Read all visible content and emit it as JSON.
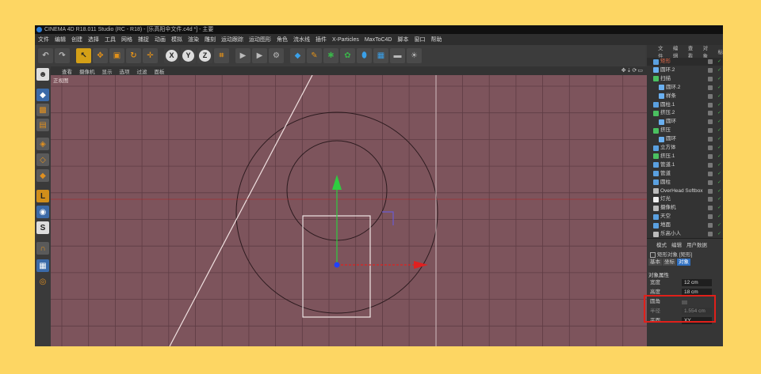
{
  "window": {
    "title": "CINEMA 4D R18.011 Studio (RC - R18) - [乐高阳伞文件.c4d *] - 主要"
  },
  "menu": [
    "文件",
    "编辑",
    "创建",
    "选择",
    "工具",
    "网格",
    "捕捉",
    "动画",
    "模拟",
    "渲染",
    "雕刻",
    "运动跟踪",
    "运动图形",
    "角色",
    "流水线",
    "插件",
    "X-Particles",
    "MaxToC4D",
    "脚本",
    "窗口",
    "帮助"
  ],
  "toolbar": {
    "axis_x": "X",
    "axis_y": "Y",
    "axis_z": "Z"
  },
  "viewport": {
    "menu": [
      "查看",
      "摄像机",
      "显示",
      "选项",
      "过滤",
      "面板"
    ],
    "label": "正视图",
    "nav_icons": "✥⇣⟳▭",
    "colors": {
      "bg": "#7d545c",
      "grid": "#5e3c44",
      "circle": "#2b1a1e",
      "rect": "#f1e6e6",
      "line": "#f0e0e0",
      "y_axis": "#2ecc40",
      "x_axis": "#e02020",
      "origin": "#2240ff"
    }
  },
  "objects_panel": {
    "tabs": [
      "文件",
      "编辑",
      "查看",
      "对象",
      "标"
    ],
    "items": [
      {
        "name": "矩形",
        "color": "#5aa0e0",
        "selected": true,
        "indent": 0,
        "name_color": "#e06a4a"
      },
      {
        "name": "圆环.2",
        "color": "#6ab0f0",
        "indent": 0
      },
      {
        "name": "扫描",
        "color": "#4ac060",
        "indent": 0
      },
      {
        "name": "圆环.2",
        "color": "#6ab0f0",
        "indent": 1
      },
      {
        "name": "样条",
        "color": "#6ab0f0",
        "indent": 1
      },
      {
        "name": "圆柱.1",
        "color": "#5aa0e0",
        "indent": 0
      },
      {
        "name": "挤压.2",
        "color": "#4ac060",
        "indent": 0
      },
      {
        "name": "圆环",
        "color": "#6ab0f0",
        "indent": 1
      },
      {
        "name": "挤压",
        "color": "#4ac060",
        "indent": 0
      },
      {
        "name": "圆环",
        "color": "#6ab0f0",
        "indent": 1
      },
      {
        "name": "立方体",
        "color": "#5aa0e0",
        "indent": 0
      },
      {
        "name": "挤压.1",
        "color": "#4ac060",
        "indent": 0
      },
      {
        "name": "管道.1",
        "color": "#5aa0e0",
        "indent": 0
      },
      {
        "name": "管道",
        "color": "#5aa0e0",
        "indent": 0
      },
      {
        "name": "圆柱",
        "color": "#5aa0e0",
        "indent": 0
      },
      {
        "name": "OverHead Softbox",
        "color": "#bbbbbb",
        "indent": 0
      },
      {
        "name": "灯光",
        "color": "#eeeeee",
        "indent": 0
      },
      {
        "name": "摄像机",
        "color": "#bbbbbb",
        "indent": 0
      },
      {
        "name": "天空",
        "color": "#5aa0e0",
        "indent": 0
      },
      {
        "name": "地面",
        "color": "#5aa0e0",
        "indent": 0
      },
      {
        "name": "乐高小人",
        "color": "#bbbbbb",
        "indent": 0
      }
    ]
  },
  "attributes": {
    "tabs": [
      "模式",
      "编辑",
      "用户数据"
    ],
    "object_title": "矩形对象 [矩形]",
    "subtabs": [
      "基本",
      "坐标",
      "对象"
    ],
    "section": "对象属性",
    "width_label": "宽度",
    "width_value": "12 cm",
    "height_label": "高度",
    "height_value": "18 cm",
    "round_label": "圆角",
    "radius_label": "半径",
    "radius_value": "1.554 cm",
    "plane_label": "平面",
    "plane_value": "XY"
  }
}
